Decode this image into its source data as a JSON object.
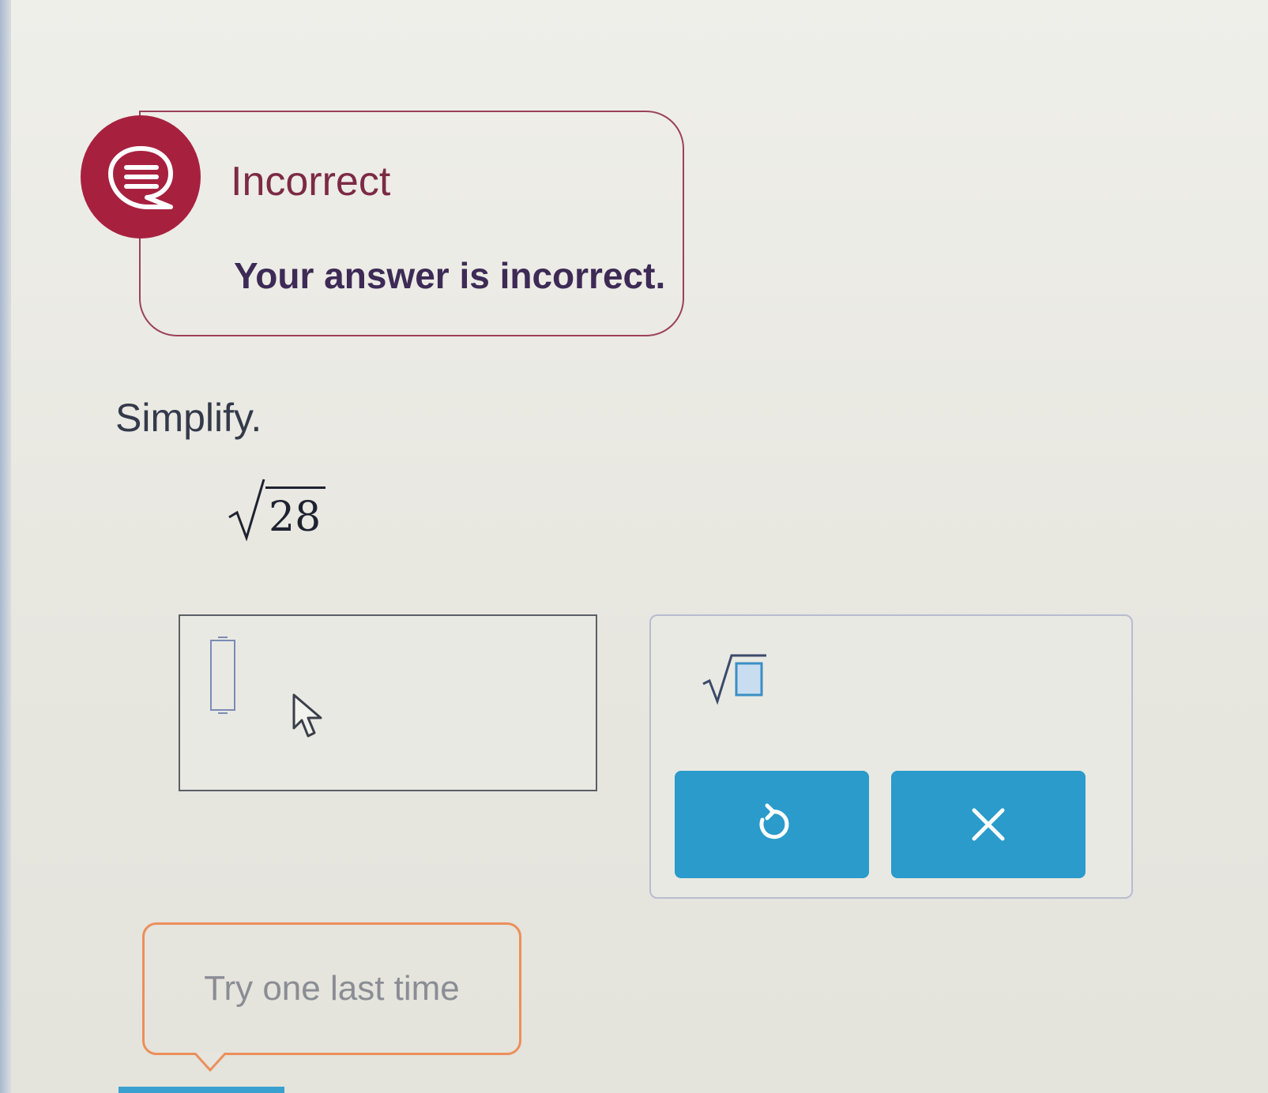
{
  "feedback": {
    "status_title": "Incorrect",
    "message": "Your answer is incorrect.",
    "badge_icon": "chat-bubble-icon",
    "badge_color": "#a7213f"
  },
  "problem": {
    "instruction": "Simplify.",
    "radicand": "28"
  },
  "answer": {
    "value": ""
  },
  "tools": {
    "items": [
      {
        "name": "square-root-template",
        "icon": "sqrt-icon"
      },
      {
        "name": "undo",
        "icon": "undo-icon"
      },
      {
        "name": "clear",
        "icon": "close-icon"
      }
    ],
    "button_color": "#2a9bca"
  },
  "hint": {
    "text": "Try one last time",
    "border_color": "#ec8f5a"
  }
}
